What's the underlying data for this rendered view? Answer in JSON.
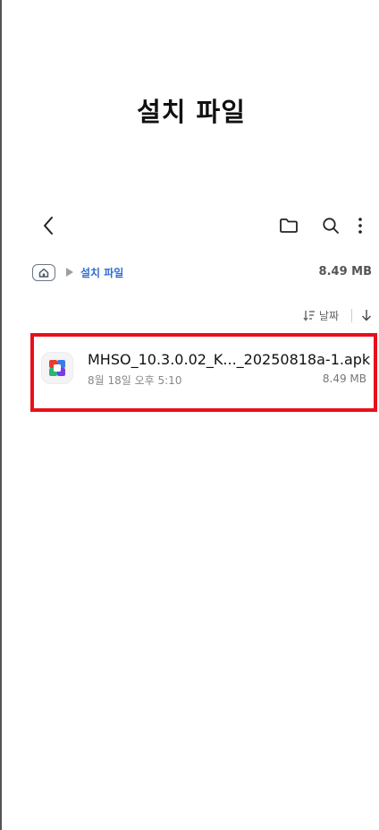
{
  "page": {
    "title": "설치 파일"
  },
  "toolbar": {
    "back_icon": "chevron-left-icon",
    "folder_icon": "folder-icon",
    "search_icon": "search-icon",
    "more_icon": "more-vertical-icon"
  },
  "breadcrumb": {
    "home_icon": "home-icon",
    "separator_icon": "triangle-right-icon",
    "current": "설치 파일",
    "size": "8.49 MB"
  },
  "sort": {
    "label": "날짜",
    "sort_icon": "sort-icon",
    "order_icon": "arrow-down-icon"
  },
  "files": [
    {
      "name": "MHSO_10.3.0.02_K..._20250818a-1.apk",
      "date": "8월 18일 오후 5:10",
      "size": "8.49 MB",
      "icon": "app-icon"
    }
  ],
  "colors": {
    "accent": "#2f6fd6",
    "highlight_border": "#e8101a"
  }
}
